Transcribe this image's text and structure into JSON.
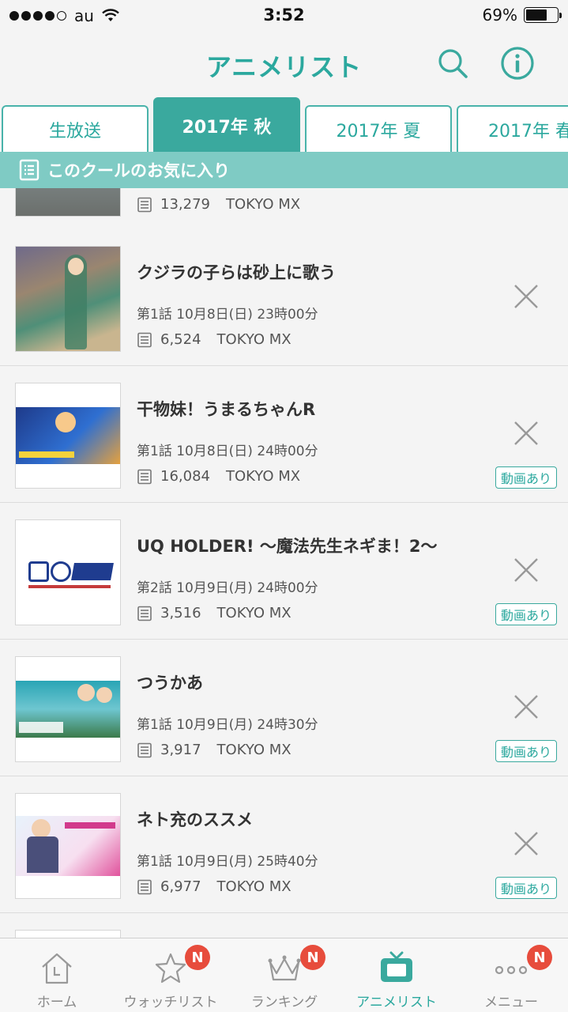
{
  "status_bar": {
    "carrier": "au",
    "time": "3:52",
    "battery": "69%",
    "battery_level": 0.69
  },
  "header": {
    "title": "アニメリスト",
    "icons": [
      "search-icon",
      "info-icon"
    ]
  },
  "tabs": [
    {
      "label": "生放送",
      "active": false
    },
    {
      "label": "2017年 秋",
      "active": true
    },
    {
      "label": "2017年 夏",
      "active": false
    },
    {
      "label": "2017年 春",
      "active": false
    }
  ],
  "favorites_bar": {
    "label": "このクールのお気に入り",
    "icon": "list-icon"
  },
  "list": {
    "partial_item": {
      "count": "13,279",
      "station": "TOKYO MX"
    },
    "items": [
      {
        "title": "クジラの子らは砂上に歌う",
        "episode": "第1話 10月8日(日) 23時00分",
        "count": "6,524",
        "station": "TOKYO MX",
        "badge": ""
      },
      {
        "title": "干物妹！うまるちゃんR",
        "episode": "第1話 10月8日(日) 24時00分",
        "count": "16,084",
        "station": "TOKYO MX",
        "badge": "動画あり"
      },
      {
        "title": "UQ HOLDER! 〜魔法先生ネギま！2〜",
        "episode": "第2話 10月9日(月) 24時00分",
        "count": "3,516",
        "station": "TOKYO MX",
        "badge": "動画あり"
      },
      {
        "title": "つうかあ",
        "episode": "第1話 10月9日(月) 24時30分",
        "count": "3,917",
        "station": "TOKYO MX",
        "badge": "動画あり"
      },
      {
        "title": "ネト充のススメ",
        "episode": "第1話 10月9日(月) 25時40分",
        "count": "6,977",
        "station": "TOKYO MX",
        "badge": "動画あり"
      }
    ]
  },
  "bottom_nav": [
    {
      "label": "ホーム",
      "icon": "home-icon",
      "badge": ""
    },
    {
      "label": "ウォッチリスト",
      "icon": "star-icon",
      "badge": "N"
    },
    {
      "label": "ランキング",
      "icon": "crown-icon",
      "badge": "N"
    },
    {
      "label": "アニメリスト",
      "icon": "tv-icon",
      "badge": "",
      "active": true
    },
    {
      "label": "メニュー",
      "icon": "more-icon",
      "badge": "N"
    }
  ],
  "colors": {
    "accent": "#3aa99e",
    "accent_light": "#7fcbc4",
    "badge_red": "#e74c3c"
  }
}
